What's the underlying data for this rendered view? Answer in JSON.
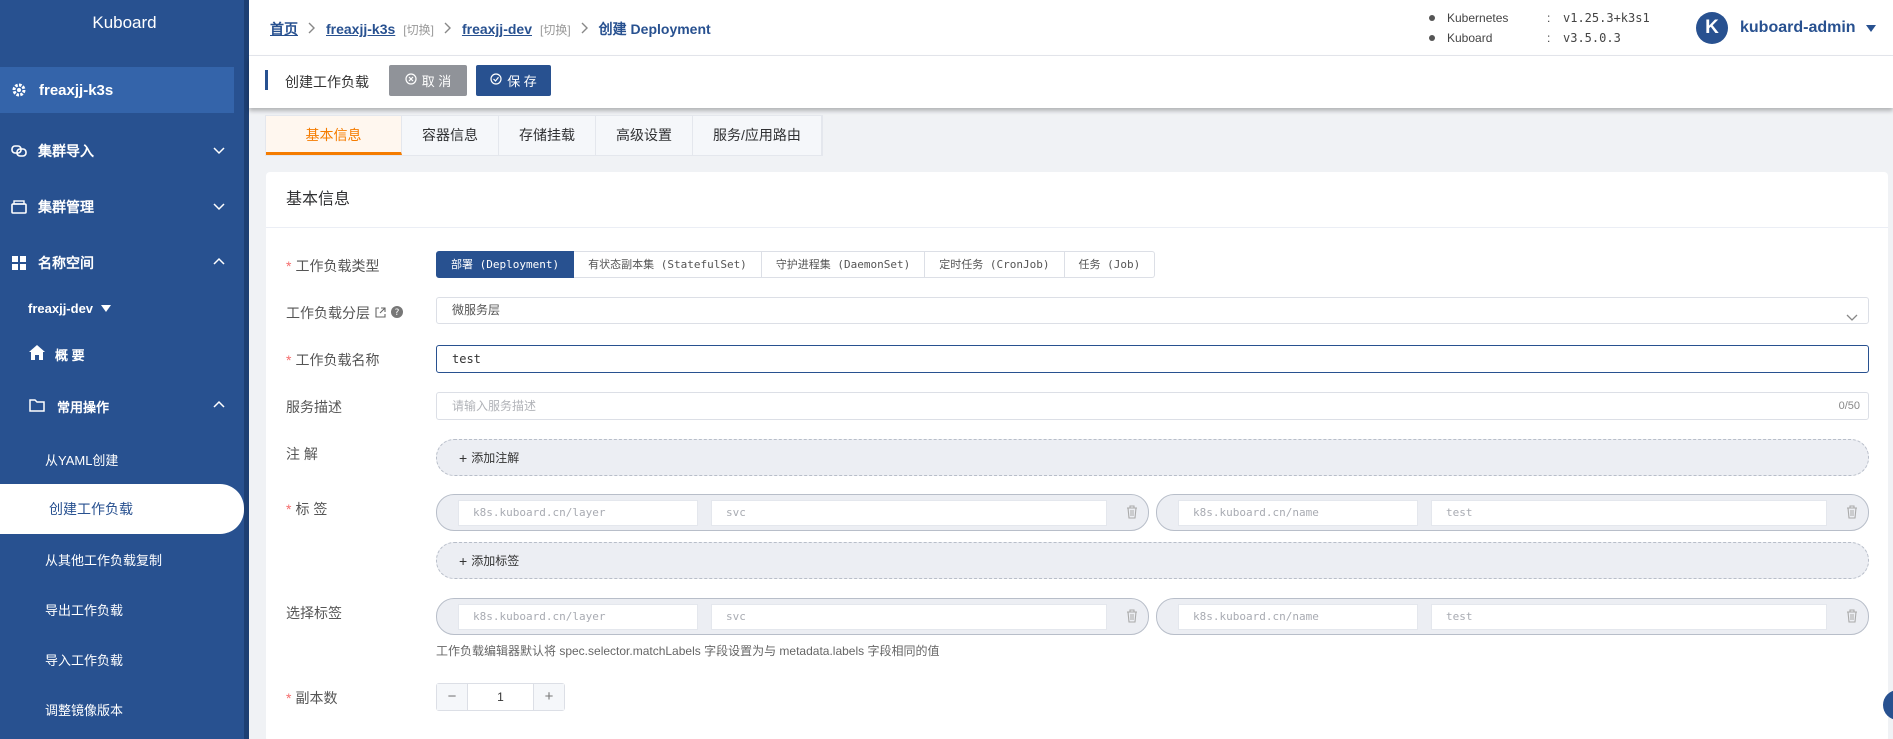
{
  "colors": {
    "brand": "#285190",
    "accent": "#f57c00",
    "required": "#f56c6c"
  },
  "sidebar": {
    "logo": "Kuboard",
    "cluster": {
      "name": "freaxjj-k3s",
      "icon": "gear-icon"
    },
    "menus": [
      {
        "label": "集群导入",
        "icon": "link-icon"
      },
      {
        "label": "集群管理",
        "icon": "storage-icon"
      },
      {
        "label": "名称空间",
        "icon": "grid-icon"
      }
    ],
    "namespace": "freaxjj-dev",
    "overview": "概 要",
    "common_ops": "常用操作",
    "ops": [
      "从YAML创建",
      "创建工作负载",
      "从其他工作负载复制",
      "导出工作负载",
      "导入工作负载",
      "调整镜像版本"
    ]
  },
  "header": {
    "breadcrumb": {
      "home": "首页",
      "cluster": "freaxjj-k3s",
      "switch1": "[切换]",
      "namespace": "freaxjj-dev",
      "switch2": "[切换]",
      "current": "创建 Deployment"
    },
    "versions": [
      {
        "name": "Kubernetes",
        "colon": ":",
        "value": "v1.25.3+k3s1"
      },
      {
        "name": "Kuboard",
        "colon": ":",
        "value": "v3.5.0.3"
      }
    ],
    "avatar_letter": "K",
    "username": "kuboard-admin"
  },
  "toolbar": {
    "title": "创建工作负载",
    "cancel": "取 消",
    "save": "保 存"
  },
  "tabs": [
    "基本信息",
    "容器信息",
    "存储挂载",
    "高级设置",
    "服务/应用路由"
  ],
  "form": {
    "section_title": "基本信息",
    "workload_type_label": "工作负载类型",
    "workload_types": [
      "部署 (Deployment)",
      "有状态副本集 (StatefulSet)",
      "守护进程集 (DaemonSet)",
      "定时任务 (CronJob)",
      "任务 (Job)"
    ],
    "layer_label": "工作负载分层",
    "layer_value": "微服务层",
    "name_label": "工作负载名称",
    "name_value": "test",
    "desc_label": "服务描述",
    "desc_placeholder": "请输入服务描述",
    "desc_counter": "0/50",
    "annotation_label": "注 解",
    "add_annotation": "添加注解",
    "labels_label": "标 签",
    "labels": [
      {
        "key": "k8s.kuboard.cn/layer",
        "value": "svc"
      },
      {
        "key": "k8s.kuboard.cn/name",
        "value": "test"
      }
    ],
    "add_label": "添加标签",
    "selector_label": "选择标签",
    "selectors": [
      {
        "key": "k8s.kuboard.cn/layer",
        "value": "svc"
      },
      {
        "key": "k8s.kuboard.cn/name",
        "value": "test"
      }
    ],
    "selector_hint": "工作负载编辑器默认将 spec.selector.matchLabels 字段设置为与 metadata.labels 字段相同的值",
    "replicas_label": "副本数",
    "replicas_value": "1",
    "minus": "−",
    "plus": "+"
  }
}
